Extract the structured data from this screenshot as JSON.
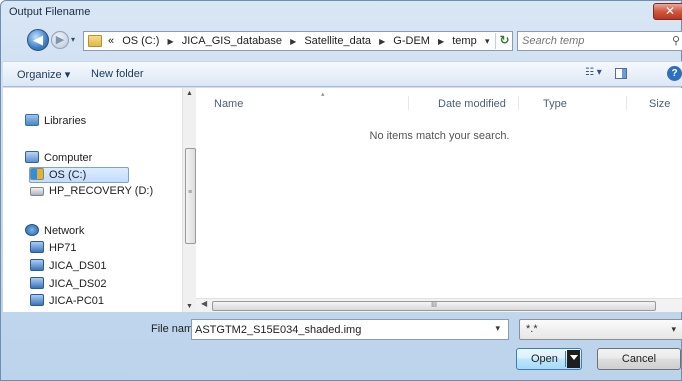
{
  "window": {
    "title": "Output Filename",
    "close_glyph": "✕"
  },
  "nav": {
    "back_glyph": "◀",
    "forward_glyph": "▶",
    "recent_glyph": "▾",
    "address": {
      "overflow": "«",
      "crumbs": [
        "OS (C:)",
        "JICA_GIS_database",
        "Satellite_data",
        "G-DEM",
        "temp"
      ],
      "separator": "▶",
      "dropdown_glyph": "▾",
      "refresh_glyph": "↻"
    },
    "search": {
      "placeholder": "Search temp",
      "icon": "search-icon",
      "glyph": "⚲"
    }
  },
  "toolbar": {
    "organize_label": "Organize ▾",
    "new_folder_label": "New folder",
    "view_glyph": "☷ ▾",
    "help_glyph": "?"
  },
  "sidebar": {
    "items": [
      {
        "label": "Libraries",
        "icon": "libraries-icon"
      },
      {
        "label": "Computer",
        "icon": "computer-icon"
      },
      {
        "label": "OS (C:)",
        "icon": "drive-icon",
        "selected": true
      },
      {
        "label": "HP_RECOVERY (D:)",
        "icon": "drive-icon"
      },
      {
        "label": "Network",
        "icon": "network-icon"
      },
      {
        "label": "HP71",
        "icon": "network-pc-icon"
      },
      {
        "label": "JICA_DS01",
        "icon": "network-pc-icon"
      },
      {
        "label": "JICA_DS02",
        "icon": "network-pc-icon"
      },
      {
        "label": "JICA-PC01",
        "icon": "network-pc-icon"
      }
    ],
    "scroll_up": "▲",
    "scroll_down": "▼",
    "scroll_grip": "≡"
  },
  "file_list": {
    "columns": [
      "Name",
      "Date modified",
      "Type",
      "Size"
    ],
    "sort_glyph": "▴",
    "empty_message": "No items match your search.",
    "hscroll_left": "◀",
    "hscroll_grip": "III"
  },
  "footer": {
    "filename_label": "File name:",
    "filename_value": "ASTGTM2_S15E034_shaded.img",
    "filename_dropdown": "▾",
    "filetype_value": "*.*",
    "filetype_dropdown": "▾",
    "open_label": "Open",
    "cancel_label": "Cancel"
  }
}
